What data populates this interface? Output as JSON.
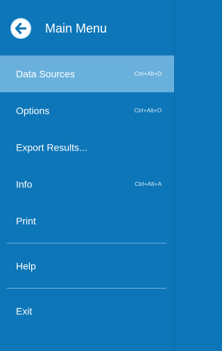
{
  "header": {
    "title": "Main Menu",
    "back_icon": "back-arrow-circle-icon"
  },
  "menu": {
    "items": [
      {
        "label": "Data Sources",
        "shortcut": "Ctrl+Alt+D",
        "selected": true
      },
      {
        "label": "Options",
        "shortcut": "Ctrl+Alt+O",
        "selected": false
      },
      {
        "label": "Export Results...",
        "shortcut": "",
        "selected": false
      },
      {
        "label": "Info",
        "shortcut": "Ctrl+Alt+A",
        "selected": false
      },
      {
        "label": "Print",
        "shortcut": "",
        "selected": false
      },
      {
        "label": "Help",
        "shortcut": "",
        "selected": false
      },
      {
        "label": "Exit",
        "shortcut": "",
        "selected": false
      }
    ]
  },
  "colors": {
    "background": "#0d76b8",
    "selected_background": "#69b1dc",
    "divider": "#6fb5df",
    "text": "#ffffff"
  }
}
